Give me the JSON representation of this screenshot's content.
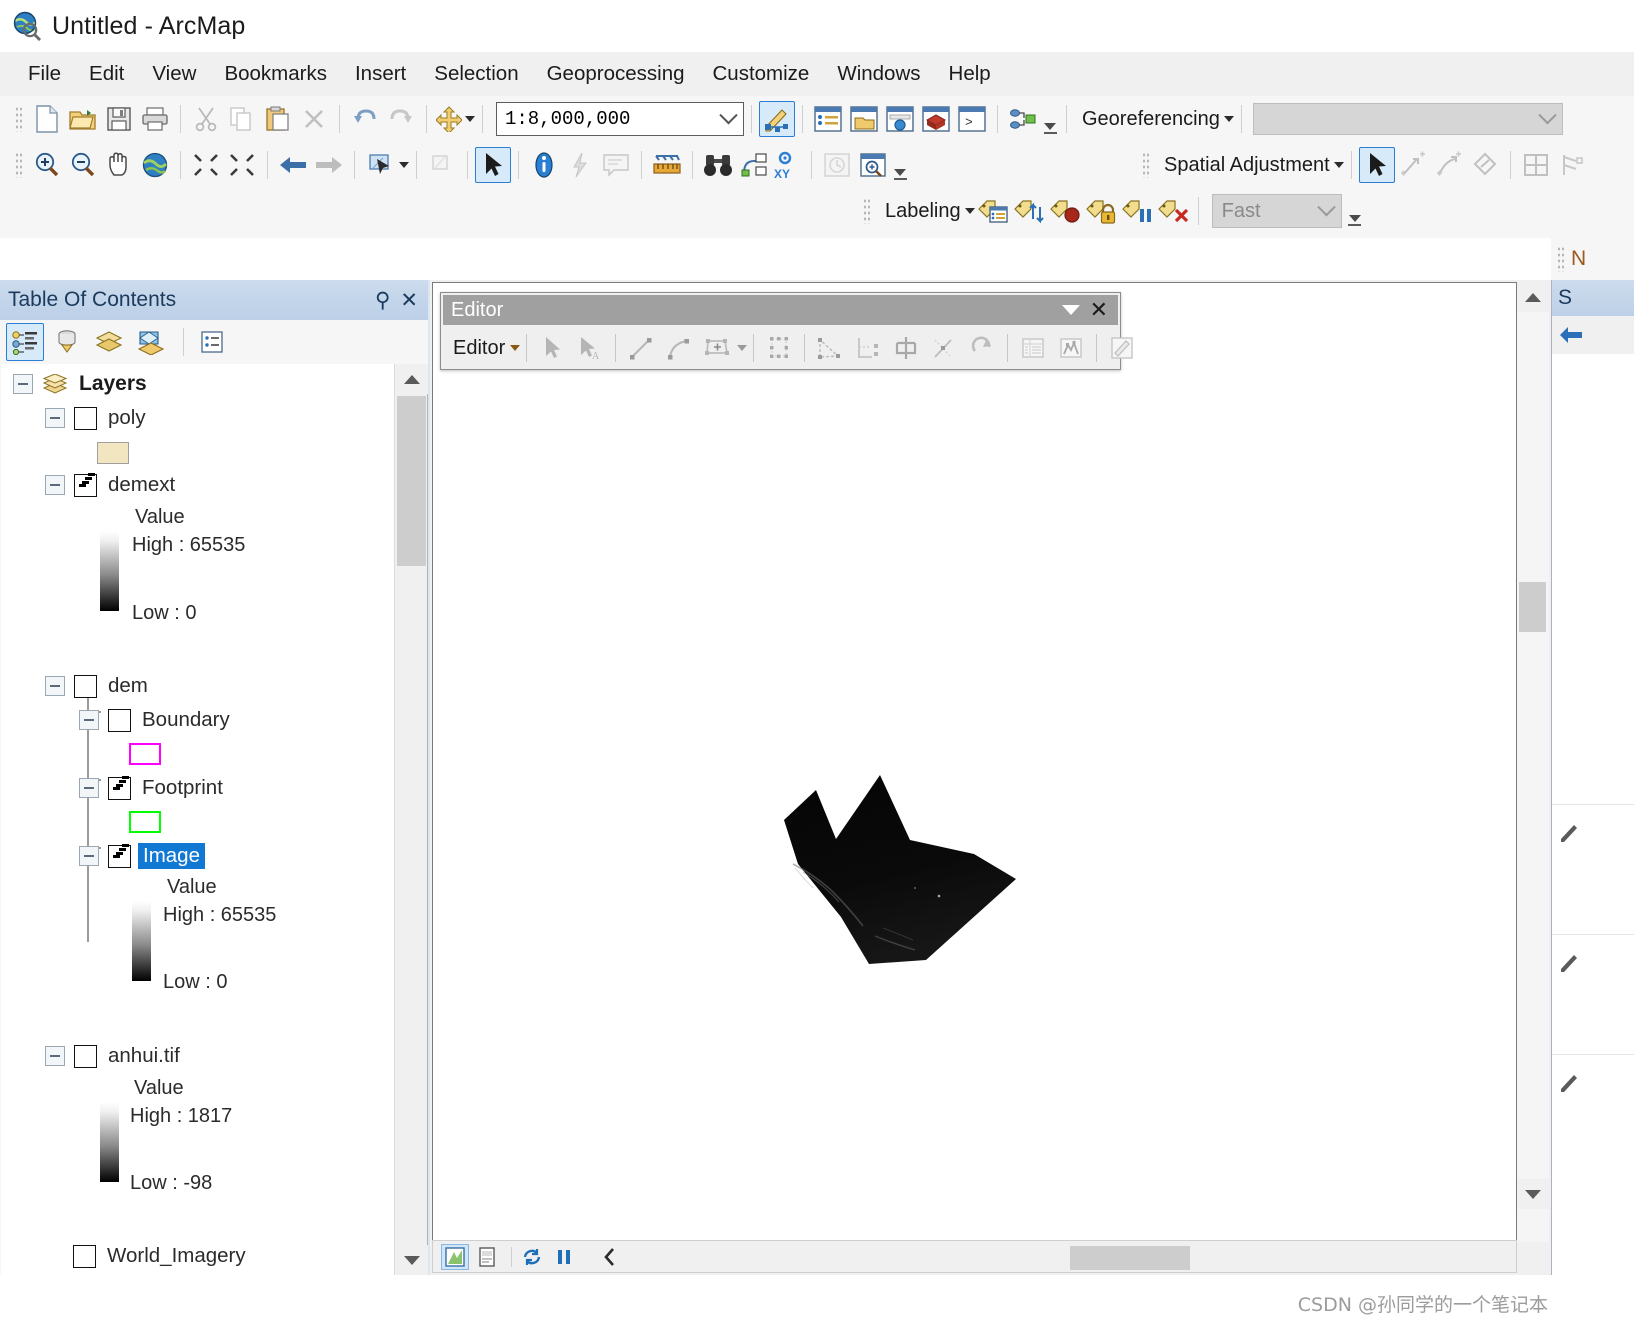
{
  "window": {
    "title": "Untitled - ArcMap",
    "app_icon": "arcmap-globe-icon"
  },
  "menu": {
    "items": [
      "File",
      "Edit",
      "View",
      "Bookmarks",
      "Insert",
      "Selection",
      "Geoprocessing",
      "Customize",
      "Windows",
      "Help"
    ]
  },
  "standard_toolbar": {
    "buttons": [
      {
        "name": "new-document-icon",
        "enabled": true
      },
      {
        "name": "open-folder-icon",
        "enabled": true
      },
      {
        "name": "save-icon",
        "enabled": true
      },
      {
        "name": "print-icon",
        "enabled": true
      },
      {
        "name": "cut-scissors-icon",
        "enabled": false
      },
      {
        "name": "copy-icon",
        "enabled": false
      },
      {
        "name": "paste-icon",
        "enabled": true
      },
      {
        "name": "delete-x-icon",
        "enabled": false
      },
      {
        "name": "undo-icon",
        "enabled": false
      },
      {
        "name": "redo-icon",
        "enabled": false
      },
      {
        "name": "add-data-icon",
        "enabled": true
      }
    ],
    "scale": {
      "value": "1:8,000,000",
      "label": "map-scale-combo"
    },
    "right_buttons": [
      {
        "name": "editor-toolbar-toggle-icon",
        "selected": true
      },
      {
        "name": "table-of-contents-icon"
      },
      {
        "name": "catalog-window-icon"
      },
      {
        "name": "search-window-icon"
      },
      {
        "name": "arctoolbox-icon"
      },
      {
        "name": "python-window-icon"
      },
      {
        "name": "model-builder-icon"
      }
    ]
  },
  "tools_toolbar": {
    "buttons": [
      {
        "name": "zoom-in-icon"
      },
      {
        "name": "zoom-out-icon"
      },
      {
        "name": "pan-hand-icon"
      },
      {
        "name": "full-extent-globe-icon"
      },
      {
        "name": "fixed-zoom-in-icon"
      },
      {
        "name": "fixed-zoom-out-icon"
      },
      {
        "name": "previous-extent-arrow-icon"
      },
      {
        "name": "next-extent-arrow-icon"
      },
      {
        "name": "select-features-icon"
      },
      {
        "name": "clear-selection-icon",
        "enabled": false
      },
      {
        "name": "select-elements-arrow-icon",
        "selected": true
      },
      {
        "name": "identify-info-icon"
      },
      {
        "name": "hyperlink-lightning-icon",
        "enabled": false
      },
      {
        "name": "html-popup-icon",
        "enabled": false
      },
      {
        "name": "measure-ruler-icon"
      },
      {
        "name": "find-binoculars-icon"
      },
      {
        "name": "find-route-icon"
      },
      {
        "name": "go-to-xy-icon"
      },
      {
        "name": "time-slider-icon",
        "enabled": false
      },
      {
        "name": "create-viewer-window-icon"
      }
    ]
  },
  "georeferencing_toolbar": {
    "label": "Georeferencing",
    "layer_combo_value": "",
    "layer_combo_placeholder": ""
  },
  "spatial_adjustment_toolbar": {
    "label": "Spatial Adjustment",
    "buttons": [
      {
        "name": "select-elements-arrow-icon",
        "selected": true
      },
      {
        "name": "new-displacement-link-icon",
        "enabled": false
      },
      {
        "name": "new-multi-displacement-link-icon",
        "enabled": false
      },
      {
        "name": "new-identity-link-icon",
        "enabled": false
      },
      {
        "name": "view-link-table-icon",
        "enabled": false
      },
      {
        "name": "edge-match-icon",
        "enabled": false
      }
    ]
  },
  "labeling_toolbar": {
    "label": "Labeling",
    "buttons": [
      {
        "name": "label-manager-icon"
      },
      {
        "name": "label-priority-ranking-icon"
      },
      {
        "name": "label-weight-ranking-icon"
      },
      {
        "name": "lock-labels-icon"
      },
      {
        "name": "pause-labeling-icon"
      },
      {
        "name": "view-unplaced-labels-icon"
      }
    ],
    "quality_select": {
      "value": "Fast",
      "name": "label-engine-quality-select"
    }
  },
  "table_of_contents": {
    "title": "Table Of Contents",
    "pin_icon": "pin-icon",
    "close_icon": "close-icon",
    "tools": [
      {
        "name": "list-by-drawing-order-icon",
        "selected": true
      },
      {
        "name": "list-by-source-icon",
        "selected": false
      },
      {
        "name": "list-by-visibility-icon",
        "selected": false
      },
      {
        "name": "list-by-selection-icon",
        "selected": false
      },
      {
        "name": "options-icon",
        "selected": false
      }
    ],
    "tree": {
      "root": {
        "label": "Layers",
        "icon": "layers-stack-icon",
        "expanded": true,
        "checked": null
      },
      "layers": [
        {
          "label": "poly",
          "checked": false,
          "expanded": true,
          "symbol": {
            "type": "polygon-fill-swatch",
            "fill": "#f2e6c0",
            "stroke": "#a0a0a0"
          }
        },
        {
          "label": "demext",
          "checked": true,
          "expanded": true,
          "legend": {
            "value_label": "Value",
            "high": "High : 65535",
            "low": "Low : 0",
            "ramp_from": "#ffffff",
            "ramp_to": "#000000"
          }
        },
        {
          "label": "dem",
          "checked": false,
          "expanded": true,
          "children": [
            {
              "label": "Boundary",
              "checked": false,
              "expanded": true,
              "symbol": {
                "type": "polygon-outline-swatch",
                "stroke": "#ff00ff"
              }
            },
            {
              "label": "Footprint",
              "checked": true,
              "expanded": true,
              "symbol": {
                "type": "polygon-outline-swatch",
                "stroke": "#00ff00"
              }
            },
            {
              "label": "Image",
              "checked": true,
              "expanded": true,
              "selected": true,
              "legend": {
                "value_label": "Value",
                "high": "High : 65535",
                "low": "Low : 0",
                "ramp_from": "#ffffff",
                "ramp_to": "#000000"
              }
            }
          ]
        },
        {
          "label": "anhui.tif",
          "checked": false,
          "expanded": true,
          "legend": {
            "value_label": "Value",
            "high": "High : 1817",
            "low": "Low : -98",
            "ramp_from": "#ffffff",
            "ramp_to": "#000000"
          }
        },
        {
          "label": "World_Imagery",
          "checked": false,
          "expanded": false
        }
      ]
    }
  },
  "editor_window": {
    "title": "Editor",
    "dropdown_icon": "chevron-down-icon",
    "close_icon": "close-icon",
    "menu_label": "Editor",
    "buttons": [
      {
        "name": "edit-tool-arrow-icon",
        "enabled": false
      },
      {
        "name": "edit-annotation-tool-icon",
        "enabled": false
      },
      {
        "name": "straight-segment-icon",
        "enabled": false
      },
      {
        "name": "endpoint-arc-segment-icon",
        "enabled": false
      },
      {
        "name": "construction-tools-icon",
        "enabled": false
      },
      {
        "name": "modify-feature-icon",
        "enabled": false
      },
      {
        "name": "reshape-feature-icon",
        "enabled": false
      },
      {
        "name": "split-tool-icon",
        "enabled": false
      },
      {
        "name": "mirror-features-icon",
        "enabled": false
      },
      {
        "name": "merge-icon",
        "enabled": false
      },
      {
        "name": "rotate-icon",
        "enabled": false
      },
      {
        "name": "attributes-icon",
        "enabled": false
      },
      {
        "name": "sketch-properties-icon",
        "enabled": false
      },
      {
        "name": "create-features-window-icon",
        "enabled": false
      }
    ]
  },
  "map_view": {
    "layer_displayed": "Image",
    "status_buttons": [
      {
        "name": "data-view-icon",
        "selected": true
      },
      {
        "name": "layout-view-icon",
        "selected": false
      },
      {
        "name": "refresh-icon",
        "selected": false
      },
      {
        "name": "pause-drawing-icon",
        "selected": false
      },
      {
        "name": "collapse-panel-chevron-icon",
        "selected": false
      }
    ],
    "raster_shape_note": "dark jagged satellite raster footprint"
  },
  "right_panel": {
    "header_label": "N",
    "title": "S"
  },
  "watermark": {
    "text": "CSDN @孙同学的一个笔记本"
  },
  "colors": {
    "accent_selection": "#1178d4",
    "titlebar_toc": "#bdd0e8",
    "magenta_outline": "#ff00ff",
    "green_outline": "#00ff00",
    "poly_fill": "#f2e6c0",
    "editor_titlebar": "#a0a0a0",
    "toolbar_bg": "#f6f6f6"
  }
}
